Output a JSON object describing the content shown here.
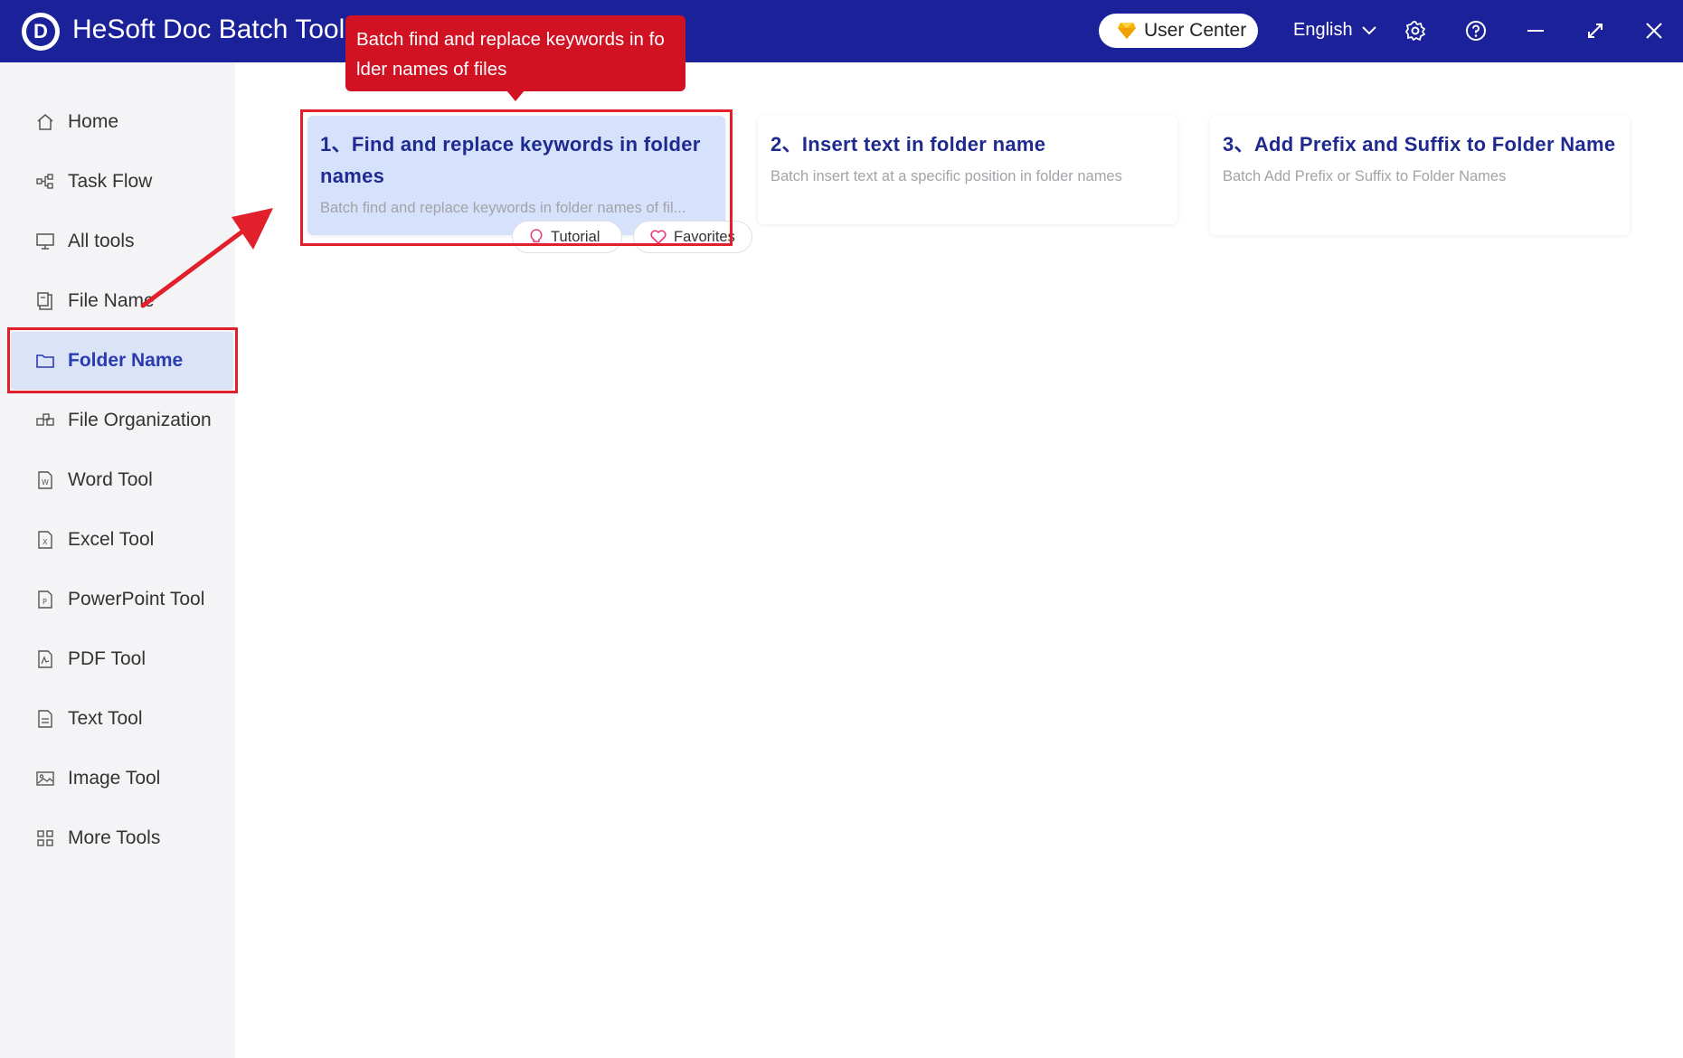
{
  "app": {
    "logo_letter": "D",
    "title": "HeSoft Doc Batch Tool"
  },
  "header": {
    "user_center": "User Center",
    "language": "English"
  },
  "sidebar": {
    "items": [
      {
        "label": "Home",
        "icon": "home-icon"
      },
      {
        "label": "Task Flow",
        "icon": "task-flow-icon"
      },
      {
        "label": "All tools",
        "icon": "monitor-icon"
      },
      {
        "label": "File Name",
        "icon": "file-name-icon"
      },
      {
        "label": "Folder Name",
        "icon": "folder-icon",
        "active": true
      },
      {
        "label": "File Organization",
        "icon": "organization-icon"
      },
      {
        "label": "Word Tool",
        "icon": "word-icon"
      },
      {
        "label": "Excel Tool",
        "icon": "excel-icon"
      },
      {
        "label": "PowerPoint Tool",
        "icon": "powerpoint-icon"
      },
      {
        "label": "PDF Tool",
        "icon": "pdf-icon"
      },
      {
        "label": "Text Tool",
        "icon": "text-icon"
      },
      {
        "label": "Image Tool",
        "icon": "image-icon"
      },
      {
        "label": "More Tools",
        "icon": "grid-icon"
      }
    ]
  },
  "cards": [
    {
      "title": "1、Find and replace keywords in folder names",
      "desc": "Batch find and replace keywords in folder names of fil..."
    },
    {
      "title": "2、Insert text in folder name",
      "desc": "Batch insert text at a specific position in folder names"
    },
    {
      "title": "3、Add Prefix and Suffix to Folder Name",
      "desc": "Batch Add Prefix or Suffix to Folder Names"
    }
  ],
  "card_actions": {
    "tutorial": "Tutorial",
    "favorites": "Favorites"
  },
  "tooltip": "Batch find and replace keywords in fo lder names of files",
  "colors": {
    "titlebar": "#1b2199",
    "accent": "#1f2a8f",
    "annotation_red": "#e2202c",
    "tooltip_red": "#d01223",
    "active_bg": "#dbe4f7"
  }
}
